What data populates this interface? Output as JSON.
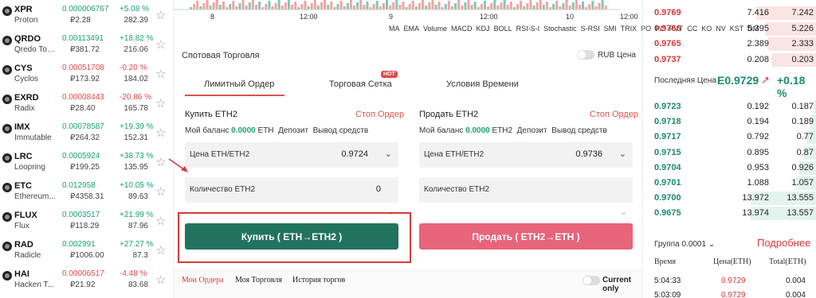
{
  "coins": [
    {
      "symbol": "XPR",
      "name": "Proton",
      "price": "0.000006767",
      "local": "₽2.28",
      "change": "+5.08 %",
      "volume": "282.39",
      "dir": "up"
    },
    {
      "symbol": "QRDO",
      "name": "Qredo Tok...",
      "price": "0.00113491",
      "local": "₽381.72",
      "change": "+18.82 %",
      "volume": "216.06",
      "dir": "up"
    },
    {
      "symbol": "CYS",
      "name": "Cyclos",
      "price": "0.00051708",
      "local": "₽173.92",
      "change": "-0.20 %",
      "volume": "184.02",
      "dir": "down"
    },
    {
      "symbol": "EXRD",
      "name": "Radix",
      "price": "0.00008443",
      "local": "₽28.40",
      "change": "-20.86 %",
      "volume": "165.78",
      "dir": "down"
    },
    {
      "symbol": "IMX",
      "name": "Immutable",
      "price": "0.00078587",
      "local": "₽264.32",
      "change": "+19.39 %",
      "volume": "152.31",
      "dir": "up"
    },
    {
      "symbol": "LRC",
      "name": "Loopring",
      "price": "0.0005924",
      "local": "₽199.25",
      "change": "+38.73 %",
      "volume": "135.95",
      "dir": "up"
    },
    {
      "symbol": "ETC",
      "name": "Ethereum...",
      "price": "0.012958",
      "local": "₽4358.31",
      "change": "+10.05 %",
      "volume": "89.63",
      "dir": "up"
    },
    {
      "symbol": "FLUX",
      "name": "Flux",
      "price": "0.0003517",
      "local": "₽118.29",
      "change": "+21.99 %",
      "volume": "87.96",
      "dir": "up"
    },
    {
      "symbol": "RAD",
      "name": "Radicle",
      "price": "0.002991",
      "local": "₽1006.00",
      "change": "+27.27 %",
      "volume": "87.3",
      "dir": "up"
    },
    {
      "symbol": "HAI",
      "name": "Hacken T...",
      "price": "0.00006517",
      "local": "₽21.92",
      "change": "-4.48 %",
      "volume": "83.68",
      "dir": "down"
    }
  ],
  "chart": {
    "axis_labels": [
      "8",
      "12:00",
      "9",
      "12:00",
      "10",
      "12:00"
    ],
    "indicators": [
      "MA",
      "EMA",
      "Volume",
      "MACD",
      "KDJ",
      "BOLL",
      "RSI-S-I",
      "Stochastic",
      "S-RSI",
      "SMI",
      "TRIX",
      "PO",
      "PC",
      "PVT",
      "CC",
      "KO",
      "NV",
      "KST",
      "DM"
    ]
  },
  "panel": {
    "title": "Спотовая Торговля",
    "rub_label": "RUB Цена",
    "tabs": [
      "Лимитный Ордер",
      "Торговая Сетка",
      "Условия Времени"
    ],
    "hot_badge": "HOT",
    "buy": {
      "header": "Купить  ETH2",
      "stop": "Стоп Ордер",
      "balance_label": "Мой баланс",
      "balance_value": "0.0000",
      "balance_unit": "ETH",
      "deposit": "Депозит",
      "withdraw": "Вывод средств",
      "price_label": "Цена ETH/ETH2",
      "price_value": "0.9724",
      "qty_label": "Количество ETH2",
      "qty_value": "0",
      "button": "Купить ( ETH→ETH2 )"
    },
    "sell": {
      "header": "Продать  ETH2",
      "stop": "Стоп Ордер",
      "balance_label": "Мой баланс",
      "balance_value": "0.0000",
      "balance_unit": "ETH2",
      "deposit": "Депозит",
      "withdraw": "Вывод средств",
      "price_label": "Цена ETH/ETH2",
      "price_value": "0.9736",
      "qty_label": "Количество ETH2",
      "button": "Продать ( ETH2→ETH )"
    }
  },
  "bottom": {
    "tabs": [
      "Мои Ордера",
      "Моя Торговля",
      "История торгов"
    ],
    "current_only": "Current only"
  },
  "book": {
    "asks": [
      {
        "price": "0.9769",
        "amount": "7.416",
        "total": "7.242",
        "depth": 0.35
      },
      {
        "price": "0.9766",
        "amount": "5.395",
        "total": "5.226",
        "depth": 0.3
      },
      {
        "price": "0.9765",
        "amount": "2.389",
        "total": "2.333",
        "depth": 0.28
      },
      {
        "price": "0.9737",
        "amount": "0.208",
        "total": "0.203",
        "depth": 0.26
      }
    ],
    "last_label": "Последняя Цена",
    "last_price": "E0.9729",
    "last_change": "+0.18 %",
    "bids": [
      {
        "price": "0.9723",
        "amount": "0.192",
        "total": "0.187",
        "depth": 0.02
      },
      {
        "price": "0.9718",
        "amount": "0.194",
        "total": "0.189",
        "depth": 0.04
      },
      {
        "price": "0.9717",
        "amount": "0.792",
        "total": "0.77",
        "depth": 0.06
      },
      {
        "price": "0.9715",
        "amount": "0.895",
        "total": "0.87",
        "depth": 0.08
      },
      {
        "price": "0.9704",
        "amount": "0.953",
        "total": "0.926",
        "depth": 0.1
      },
      {
        "price": "0.9701",
        "amount": "1.088",
        "total": "1.057",
        "depth": 0.12
      },
      {
        "price": "0.9700",
        "amount": "13.972",
        "total": "13.555",
        "depth": 0.38
      },
      {
        "price": "0.9675",
        "amount": "13.974",
        "total": "13.557",
        "depth": 0.38
      }
    ],
    "group": "Группа 0.0001",
    "more": "Подробнее",
    "trade_headers": [
      "Время",
      "Цена(ETH)",
      "Total(ETH)"
    ],
    "trades": [
      {
        "time": "5:04:33",
        "price": "0.9729",
        "total": "0.004"
      },
      {
        "time": "5:03:09",
        "price": "0.9729",
        "total": "0.004"
      }
    ]
  }
}
